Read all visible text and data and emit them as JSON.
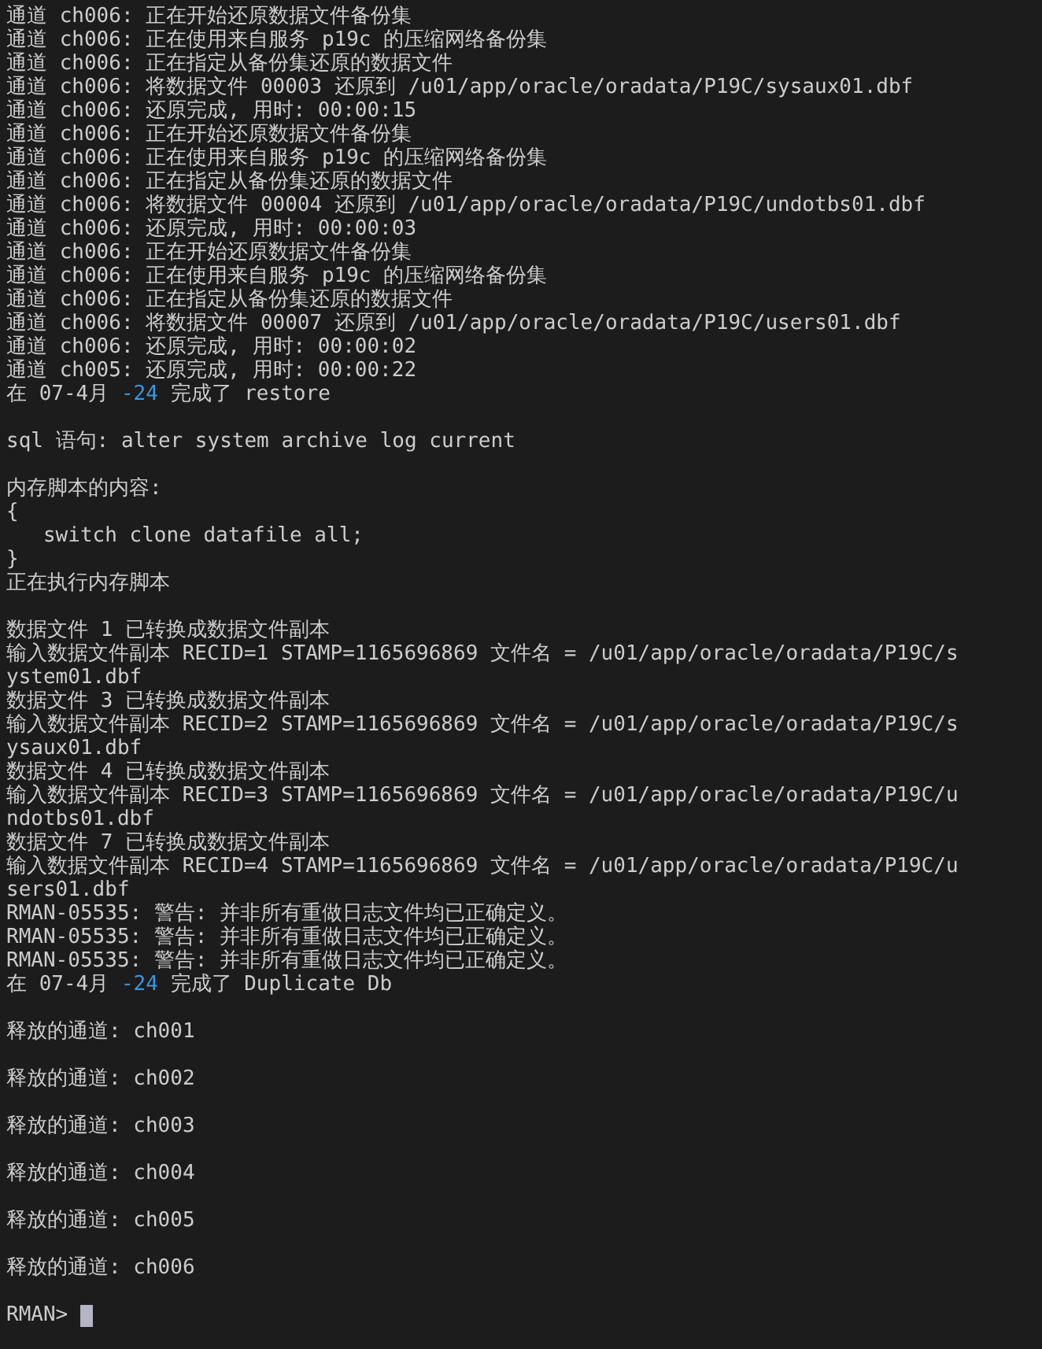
{
  "terminal": {
    "lines": [
      {
        "kind": "text",
        "text": "通道 ch006: 正在开始还原数据文件备份集"
      },
      {
        "kind": "text",
        "text": "通道 ch006: 正在使用来自服务 p19c 的压缩网络备份集"
      },
      {
        "kind": "text",
        "text": "通道 ch006: 正在指定从备份集还原的数据文件"
      },
      {
        "kind": "text",
        "text": "通道 ch006: 将数据文件 00003 还原到 /u01/app/oracle/oradata/P19C/sysaux01.dbf"
      },
      {
        "kind": "text",
        "text": "通道 ch006: 还原完成, 用时: 00:00:15"
      },
      {
        "kind": "text",
        "text": "通道 ch006: 正在开始还原数据文件备份集"
      },
      {
        "kind": "text",
        "text": "通道 ch006: 正在使用来自服务 p19c 的压缩网络备份集"
      },
      {
        "kind": "text",
        "text": "通道 ch006: 正在指定从备份集还原的数据文件"
      },
      {
        "kind": "text",
        "text": "通道 ch006: 将数据文件 00004 还原到 /u01/app/oracle/oradata/P19C/undotbs01.dbf"
      },
      {
        "kind": "text",
        "text": "通道 ch006: 还原完成, 用时: 00:00:03"
      },
      {
        "kind": "text",
        "text": "通道 ch006: 正在开始还原数据文件备份集"
      },
      {
        "kind": "text",
        "text": "通道 ch006: 正在使用来自服务 p19c 的压缩网络备份集"
      },
      {
        "kind": "text",
        "text": "通道 ch006: 正在指定从备份集还原的数据文件"
      },
      {
        "kind": "text",
        "text": "通道 ch006: 将数据文件 00007 还原到 /u01/app/oracle/oradata/P19C/users01.dbf"
      },
      {
        "kind": "text",
        "text": "通道 ch006: 还原完成, 用时: 00:00:02"
      },
      {
        "kind": "text",
        "text": "通道 ch005: 还原完成, 用时: 00:00:22"
      },
      {
        "kind": "mixed",
        "parts": [
          {
            "text": "在 07-4月 "
          },
          {
            "text": "-24",
            "color": "#3a96dd"
          },
          {
            "text": " 完成了 restore"
          }
        ]
      },
      {
        "kind": "blank"
      },
      {
        "kind": "text",
        "text": "sql 语句: alter system archive log current"
      },
      {
        "kind": "blank"
      },
      {
        "kind": "text",
        "text": "内存脚本的内容:"
      },
      {
        "kind": "text",
        "text": "{"
      },
      {
        "kind": "text",
        "text": "   switch clone datafile all;"
      },
      {
        "kind": "text",
        "text": "}"
      },
      {
        "kind": "text",
        "text": "正在执行内存脚本"
      },
      {
        "kind": "blank"
      },
      {
        "kind": "text",
        "text": "数据文件 1 已转换成数据文件副本"
      },
      {
        "kind": "text",
        "text": "输入数据文件副本 RECID=1 STAMP=1165696869 文件名 = /u01/app/oracle/oradata/P19C/s"
      },
      {
        "kind": "text",
        "text": "ystem01.dbf"
      },
      {
        "kind": "text",
        "text": "数据文件 3 已转换成数据文件副本"
      },
      {
        "kind": "text",
        "text": "输入数据文件副本 RECID=2 STAMP=1165696869 文件名 = /u01/app/oracle/oradata/P19C/s"
      },
      {
        "kind": "text",
        "text": "ysaux01.dbf"
      },
      {
        "kind": "text",
        "text": "数据文件 4 已转换成数据文件副本"
      },
      {
        "kind": "text",
        "text": "输入数据文件副本 RECID=3 STAMP=1165696869 文件名 = /u01/app/oracle/oradata/P19C/u"
      },
      {
        "kind": "text",
        "text": "ndotbs01.dbf"
      },
      {
        "kind": "text",
        "text": "数据文件 7 已转换成数据文件副本"
      },
      {
        "kind": "text",
        "text": "输入数据文件副本 RECID=4 STAMP=1165696869 文件名 = /u01/app/oracle/oradata/P19C/u"
      },
      {
        "kind": "text",
        "text": "sers01.dbf"
      },
      {
        "kind": "text",
        "text": "RMAN-05535: 警告: 并非所有重做日志文件均已正确定义。"
      },
      {
        "kind": "text",
        "text": "RMAN-05535: 警告: 并非所有重做日志文件均已正确定义。"
      },
      {
        "kind": "text",
        "text": "RMAN-05535: 警告: 并非所有重做日志文件均已正确定义。"
      },
      {
        "kind": "mixed",
        "parts": [
          {
            "text": "在 07-4月 "
          },
          {
            "text": "-24",
            "color": "#3a96dd"
          },
          {
            "text": " 完成了 Duplicate Db"
          }
        ]
      },
      {
        "kind": "blank"
      },
      {
        "kind": "text",
        "text": "释放的通道: ch001"
      },
      {
        "kind": "blank"
      },
      {
        "kind": "text",
        "text": "释放的通道: ch002"
      },
      {
        "kind": "blank"
      },
      {
        "kind": "text",
        "text": "释放的通道: ch003"
      },
      {
        "kind": "blank"
      },
      {
        "kind": "text",
        "text": "释放的通道: ch004"
      },
      {
        "kind": "blank"
      },
      {
        "kind": "text",
        "text": "释放的通道: ch005"
      },
      {
        "kind": "blank"
      },
      {
        "kind": "text",
        "text": "释放的通道: ch006"
      },
      {
        "kind": "blank"
      }
    ],
    "prompt": {
      "text": "RMAN>",
      "cursor": true
    }
  }
}
